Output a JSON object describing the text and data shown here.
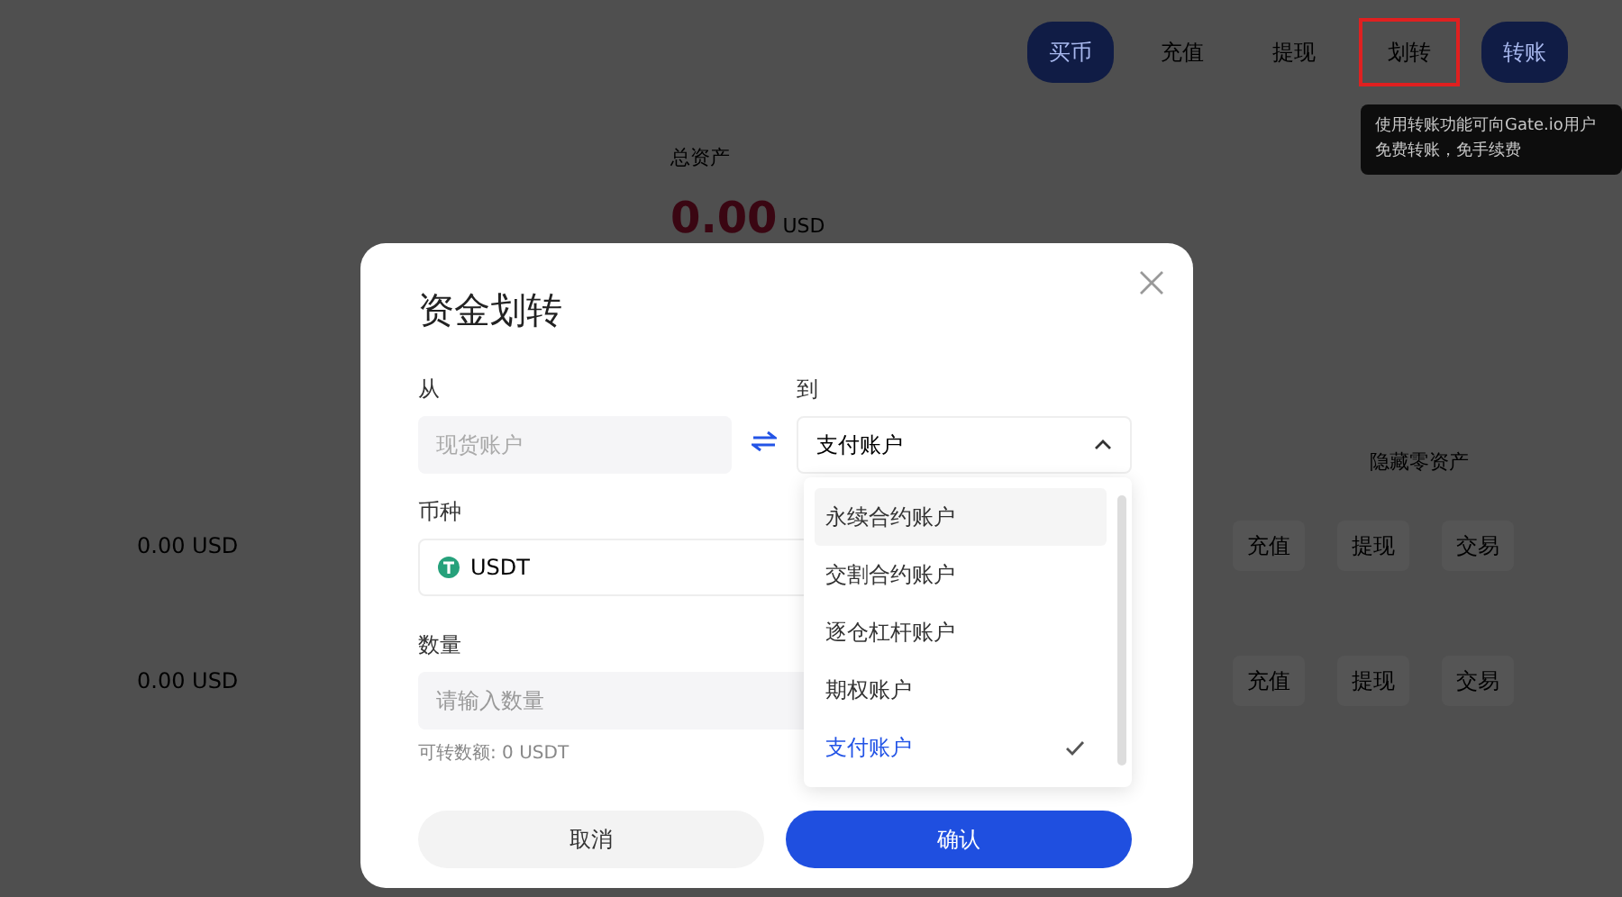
{
  "page": {
    "nav_buttons": [
      {
        "label": "买币",
        "kind": "pill"
      },
      {
        "label": "充值",
        "kind": "plain"
      },
      {
        "label": "提现",
        "kind": "plain"
      },
      {
        "label": "划转",
        "kind": "outlined"
      },
      {
        "label": "转账",
        "kind": "pill"
      }
    ],
    "tooltip": "使用转账功能可向Gate.io用户免费转账，免手续费",
    "total": {
      "label": "总资产",
      "amount": "0.00",
      "unit": "USD"
    },
    "hide_zero": "隐藏零资产",
    "rows": [
      {
        "value": "0.00 USD",
        "actions": [
          "充值",
          "提现",
          "交易"
        ]
      },
      {
        "value": "0.00 USD",
        "actions": [
          "充值",
          "提现",
          "交易"
        ]
      }
    ]
  },
  "dialog": {
    "title": "资金划转",
    "from": {
      "label": "从",
      "value": "现货账户",
      "disabled": true
    },
    "to": {
      "label": "到",
      "value": "支付账户",
      "expanded": true
    },
    "coin": {
      "label": "币种",
      "value": "USDT"
    },
    "amount": {
      "label": "数量",
      "placeholder": "请输入数量",
      "hint": "可转数额: 0 USDT"
    },
    "options": [
      {
        "label": "永续合约账户",
        "hovered": true,
        "selected": false
      },
      {
        "label": "交割合约账户",
        "hovered": false,
        "selected": false
      },
      {
        "label": "逐仓杠杆账户",
        "hovered": false,
        "selected": false
      },
      {
        "label": "期权账户",
        "hovered": false,
        "selected": false
      },
      {
        "label": "支付账户",
        "hovered": false,
        "selected": true
      }
    ],
    "buttons": [
      {
        "label": "取消",
        "kind": "secondary"
      },
      {
        "label": "确认",
        "kind": "primary"
      }
    ]
  }
}
